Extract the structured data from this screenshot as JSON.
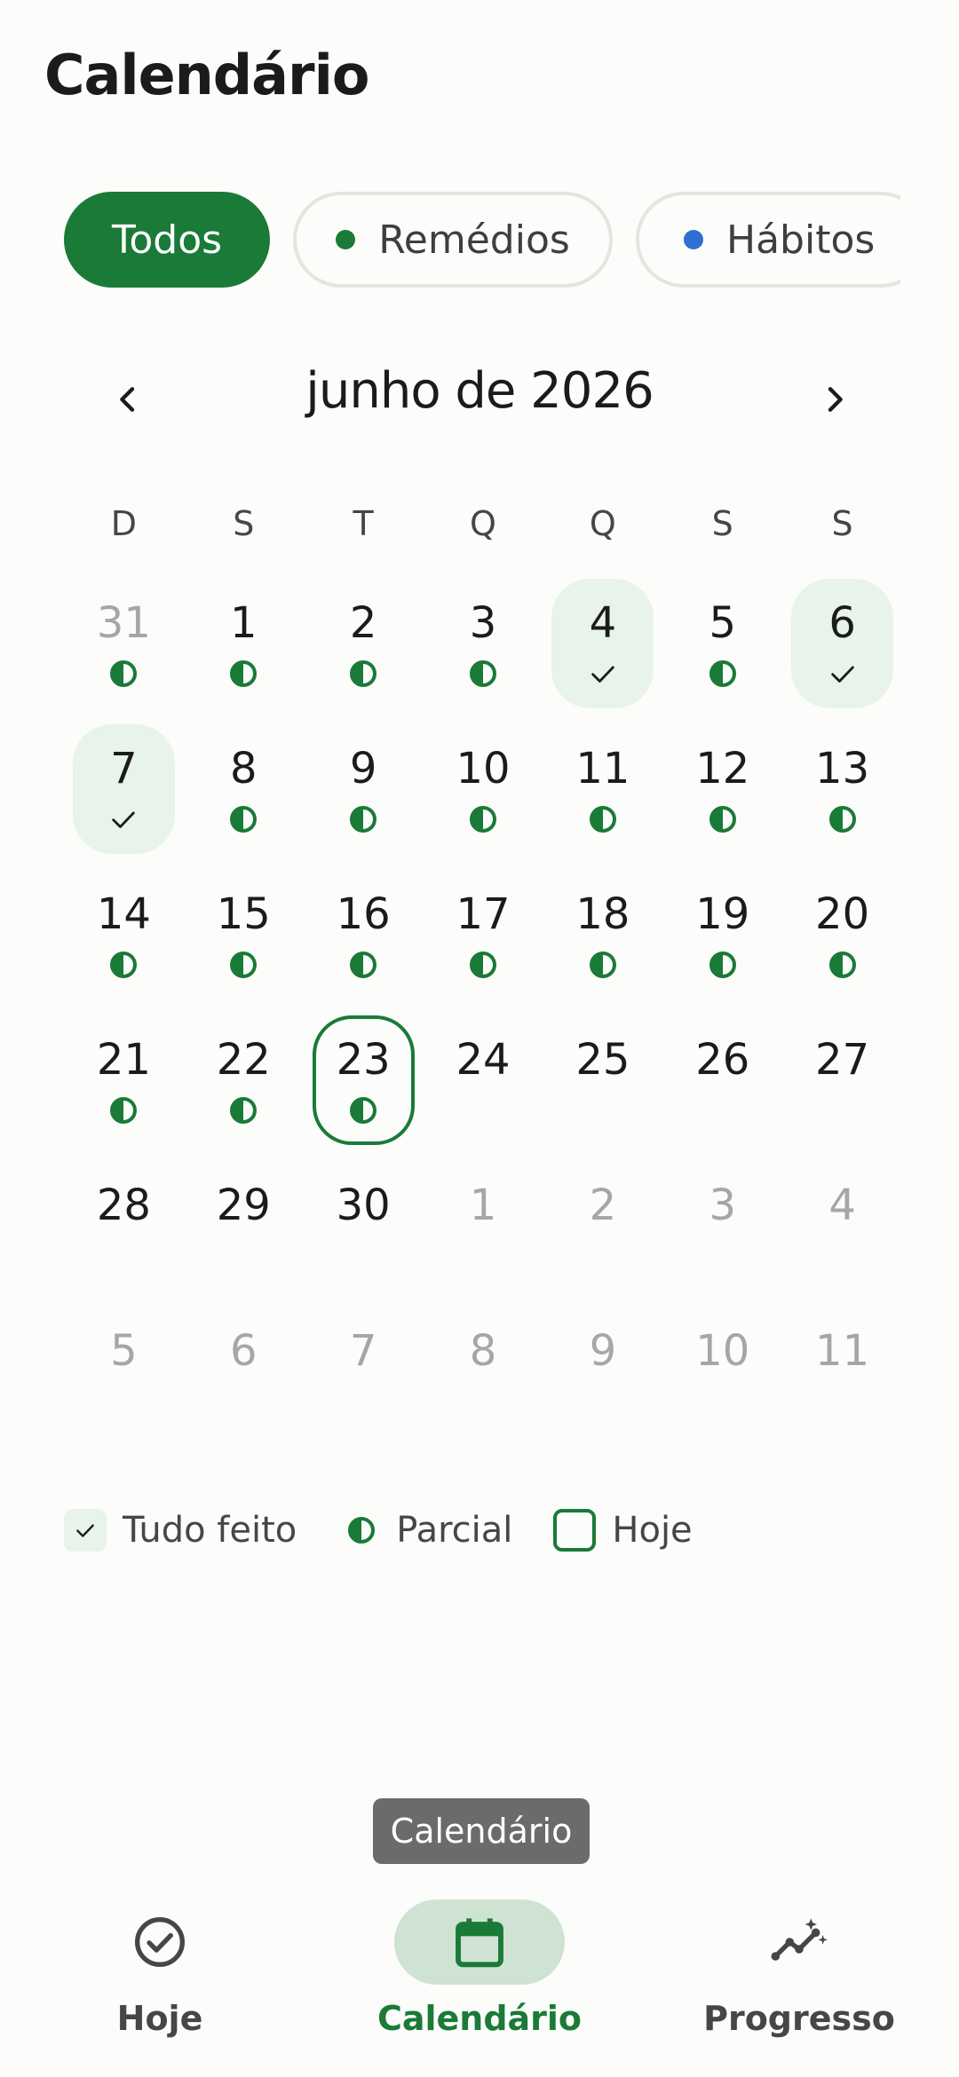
{
  "header": {
    "title": "Calendário"
  },
  "filters": {
    "items": [
      {
        "label": "Todos",
        "active": true
      },
      {
        "label": "Remédios",
        "dot_color": "#1a7a37",
        "active": false
      },
      {
        "label": "Hábitos",
        "dot_color": "#2f6fd0",
        "active": false
      }
    ]
  },
  "calendar": {
    "month_label": "junho de 2026",
    "prev_icon": "chevron-left-icon",
    "next_icon": "chevron-right-icon",
    "weekdays": [
      "D",
      "S",
      "T",
      "Q",
      "Q",
      "S",
      "S"
    ],
    "days": [
      {
        "n": "31",
        "out": true,
        "mark": "half"
      },
      {
        "n": "1",
        "mark": "half"
      },
      {
        "n": "2",
        "mark": "half"
      },
      {
        "n": "3",
        "mark": "half"
      },
      {
        "n": "4",
        "mark": "check",
        "done": true
      },
      {
        "n": "5",
        "mark": "half"
      },
      {
        "n": "6",
        "mark": "check",
        "done": true
      },
      {
        "n": "7",
        "mark": "check",
        "done": true
      },
      {
        "n": "8",
        "mark": "half"
      },
      {
        "n": "9",
        "mark": "half"
      },
      {
        "n": "10",
        "mark": "half"
      },
      {
        "n": "11",
        "mark": "half"
      },
      {
        "n": "12",
        "mark": "half"
      },
      {
        "n": "13",
        "mark": "half"
      },
      {
        "n": "14",
        "mark": "half"
      },
      {
        "n": "15",
        "mark": "half"
      },
      {
        "n": "16",
        "mark": "half"
      },
      {
        "n": "17",
        "mark": "half"
      },
      {
        "n": "18",
        "mark": "half"
      },
      {
        "n": "19",
        "mark": "half"
      },
      {
        "n": "20",
        "mark": "half"
      },
      {
        "n": "21",
        "mark": "half"
      },
      {
        "n": "22",
        "mark": "half"
      },
      {
        "n": "23",
        "mark": "half",
        "today": true
      },
      {
        "n": "24"
      },
      {
        "n": "25"
      },
      {
        "n": "26"
      },
      {
        "n": "27"
      },
      {
        "n": "28"
      },
      {
        "n": "29"
      },
      {
        "n": "30"
      },
      {
        "n": "1",
        "out": true
      },
      {
        "n": "2",
        "out": true
      },
      {
        "n": "3",
        "out": true
      },
      {
        "n": "4",
        "out": true
      },
      {
        "n": "5",
        "out": true
      },
      {
        "n": "6",
        "out": true
      },
      {
        "n": "7",
        "out": true
      },
      {
        "n": "8",
        "out": true
      },
      {
        "n": "9",
        "out": true
      },
      {
        "n": "10",
        "out": true
      },
      {
        "n": "11",
        "out": true
      }
    ]
  },
  "legend": {
    "done": "Tudo feito",
    "partial": "Parcial",
    "today": "Hoje"
  },
  "tooltip": "Calendário",
  "bottom_nav": {
    "items": [
      {
        "label": "Hoje",
        "icon": "check-circle-icon",
        "active": false
      },
      {
        "label": "Calendário",
        "icon": "calendar-icon",
        "active": true
      },
      {
        "label": "Progresso",
        "icon": "progress-chart-icon",
        "active": false
      }
    ]
  },
  "colors": {
    "accent": "#1a7a37",
    "done_bg": "#e8f3ea",
    "habit_blue": "#2f6fd0",
    "outside_text": "#a5a7a4"
  }
}
